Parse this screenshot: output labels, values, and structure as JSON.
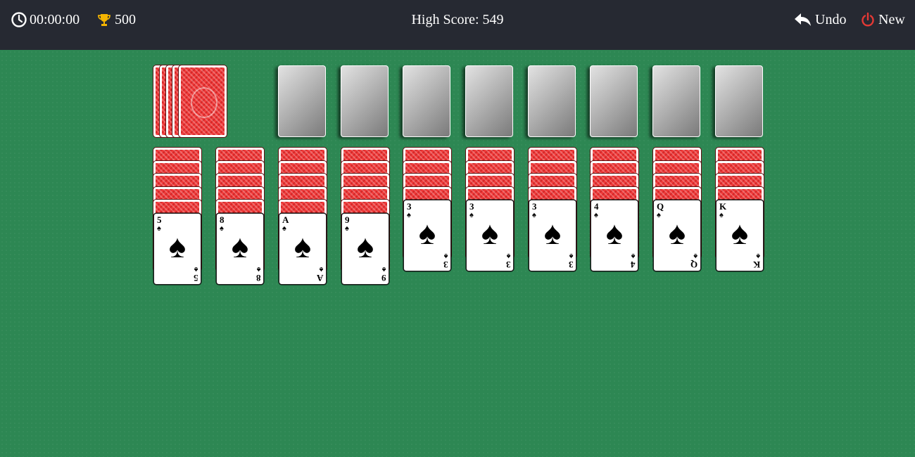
{
  "header": {
    "timer": "00:00:00",
    "score": "500",
    "high_score": "High Score: 549",
    "undo_label": "Undo",
    "new_label": "New"
  },
  "colors": {
    "topbar": "#262932",
    "felt": "#2d8753",
    "card_back": "#f03a3a",
    "trophy": "#f4b400",
    "new_icon": "#e53935"
  },
  "stock": {
    "card_count_visible": 5,
    "icon": "card-back"
  },
  "foundations": {
    "count": 8
  },
  "tableau": [
    {
      "face_down": 5,
      "face_up": [
        {
          "rank": "5",
          "suit": "♠"
        }
      ]
    },
    {
      "face_down": 5,
      "face_up": [
        {
          "rank": "8",
          "suit": "♠"
        }
      ]
    },
    {
      "face_down": 5,
      "face_up": [
        {
          "rank": "A",
          "suit": "♠"
        }
      ]
    },
    {
      "face_down": 5,
      "face_up": [
        {
          "rank": "9",
          "suit": "♠"
        }
      ]
    },
    {
      "face_down": 4,
      "face_up": [
        {
          "rank": "3",
          "suit": "♠"
        }
      ]
    },
    {
      "face_down": 4,
      "face_up": [
        {
          "rank": "3",
          "suit": "♠"
        }
      ]
    },
    {
      "face_down": 4,
      "face_up": [
        {
          "rank": "3",
          "suit": "♠"
        }
      ]
    },
    {
      "face_down": 4,
      "face_up": [
        {
          "rank": "4",
          "suit": "♠"
        }
      ]
    },
    {
      "face_down": 4,
      "face_up": [
        {
          "rank": "Q",
          "suit": "♠"
        }
      ]
    },
    {
      "face_down": 4,
      "face_up": [
        {
          "rank": "K",
          "suit": "♠"
        }
      ]
    }
  ]
}
